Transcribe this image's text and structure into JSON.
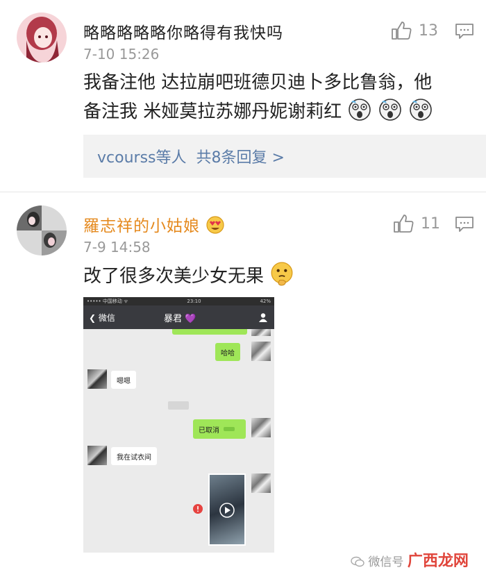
{
  "comments": [
    {
      "username": "略略略略略你略得有我快吗",
      "time": "7-10 15:26",
      "likes": "13",
      "text_line1": "我备注他 达拉崩吧班德贝迪卜多比鲁翁，他",
      "text_line2": "备注我 米娅莫拉苏娜丹妮谢莉红",
      "emojis": [
        "scared-face",
        "scared-face",
        "scared-face"
      ],
      "replies_user": "vcourss等人",
      "replies_count": "共8条回复 >"
    },
    {
      "username": "羅志祥的小姑娘",
      "time": "7-9 14:58",
      "likes": "11",
      "text": "改了很多次美少女无果",
      "emojis": [
        "thinking-face"
      ],
      "chat_screenshot": {
        "carrier": "••••• 中国移动 ᯤ",
        "clock": "23:10",
        "battery": "42%",
        "back_label": "微信",
        "title": "暴君",
        "messages": [
          {
            "side": "right",
            "text": "哈哈"
          },
          {
            "side": "left",
            "text": "嗯嗯"
          },
          {
            "side": "right",
            "text": "已取消"
          },
          {
            "side": "left",
            "text": "我在试衣间"
          }
        ]
      }
    }
  ],
  "watermark": {
    "text": "微信号",
    "brand": "广西龙网"
  },
  "colors": {
    "username_first": "#222222",
    "username_second": "#e58a1f",
    "reply_link": "#5b7ca8",
    "meta_gray": "#999999"
  }
}
